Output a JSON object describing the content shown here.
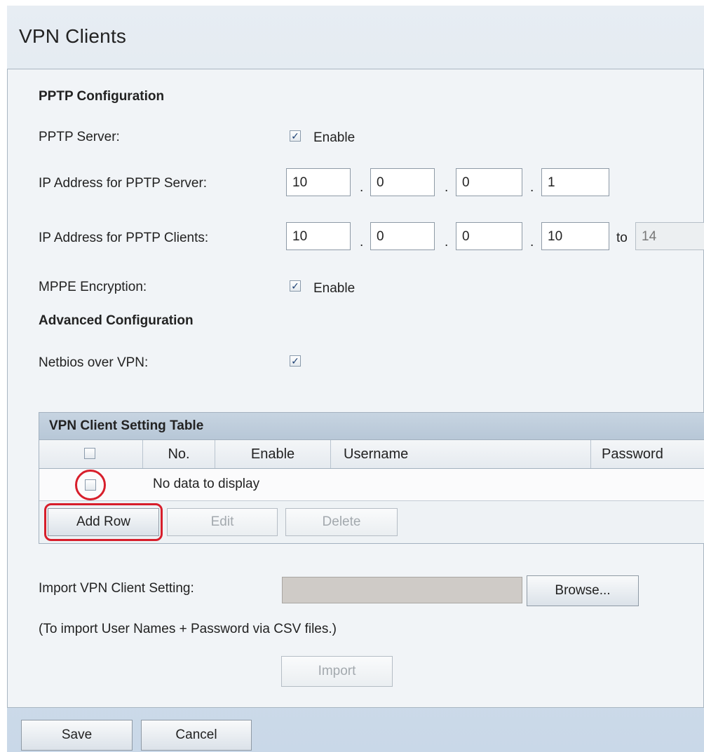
{
  "page": {
    "title": "VPN Clients"
  },
  "pptp": {
    "section_title": "PPTP Configuration",
    "server_label": "PPTP Server:",
    "server_enable_label": "Enable",
    "server_ip_label": "IP Address for PPTP Server:",
    "server_ip": [
      "10",
      "0",
      "0",
      "1"
    ],
    "client_ip_label": "IP Address for PPTP Clients:",
    "client_ip": [
      "10",
      "0",
      "0",
      "10"
    ],
    "client_ip_to_label": "to",
    "client_ip_end": "14",
    "mppe_label": "MPPE Encryption:",
    "mppe_enable_label": "Enable",
    "ip_separator": "."
  },
  "advanced": {
    "section_title": "Advanced Configuration",
    "netbios_label": "Netbios over VPN:"
  },
  "checkbox_glyph": "✓",
  "table": {
    "title": "VPN Client Setting Table",
    "columns": [
      "No.",
      "Enable",
      "Username",
      "Password"
    ],
    "empty_message": "No data to display",
    "add_row_label": "Add Row",
    "edit_label": "Edit",
    "delete_label": "Delete"
  },
  "import": {
    "label": "Import VPN Client Setting:",
    "browse_label": "Browse...",
    "hint": "(To import User Names + Password via CSV files.)",
    "import_label": "Import"
  },
  "footer": {
    "save_label": "Save",
    "cancel_label": "Cancel"
  },
  "colors": {
    "highlight": "#d71e2b",
    "header_bg": "#b7c7d7"
  }
}
